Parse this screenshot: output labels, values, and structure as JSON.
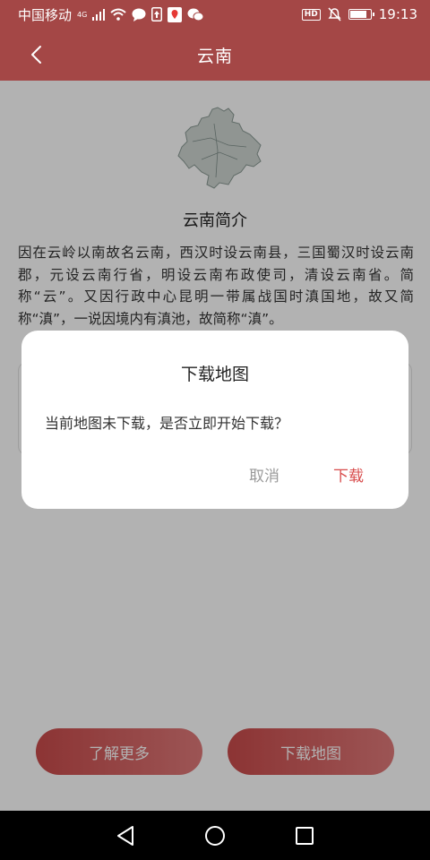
{
  "status_bar": {
    "carrier": "中国移动",
    "network": "4G",
    "time": "19:13",
    "hd_badge": "HD"
  },
  "header": {
    "title": "云南"
  },
  "intro": {
    "title": "云南简介",
    "text": "因在云岭以南故名云南，西汉时设云南县，三国蜀汉时设云南郡，元设云南行省，明设云南布政使司，清设云南省。简称“云”。又因行政中心昆明一带属战国时滇国地，故又简称“滇”，一说因境内有滇池，故简称“滇”。"
  },
  "bottom_buttons": {
    "learn_more": "了解更多",
    "download_map": "下载地图"
  },
  "dialog": {
    "title": "下载地图",
    "message": "当前地图未下载，是否立即开始下载？",
    "cancel": "取消",
    "confirm": "下载"
  },
  "colors": {
    "primary": "#a44746",
    "accent": "#d84c4c"
  },
  "battery_level": 0.85
}
